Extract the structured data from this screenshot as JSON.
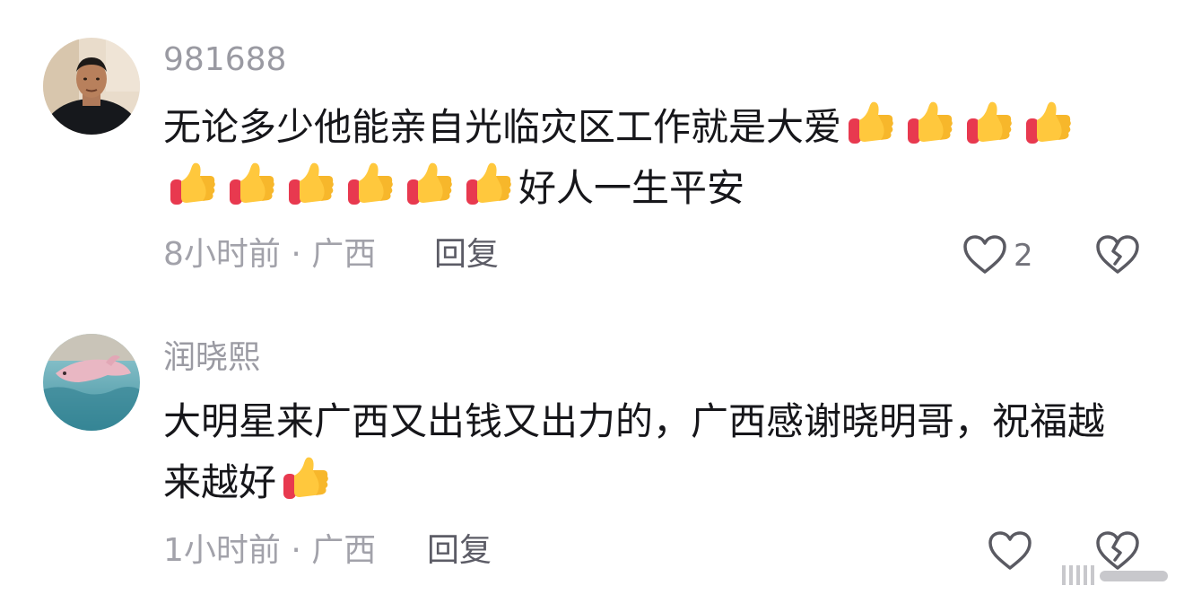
{
  "comments": [
    {
      "username": "981688",
      "avatar_icon": "user-avatar-man-photo",
      "text_before_emoji": "无论多少他能亲自光临灾区工作就是大爱",
      "text_after_emoji": "好人一生平安",
      "emoji_name": "thumbs-up-icon",
      "emoji_count": 10,
      "meta": "8小时前 · 广西",
      "reply_label": "回复",
      "like_count": "2"
    },
    {
      "username": "润晓熙",
      "avatar_icon": "user-avatar-dolphin-photo",
      "text_before_emoji": "大明星来广西又出钱又出力的，广西感谢晓明哥，祝福越来越好",
      "text_after_emoji": "",
      "emoji_name": "thumbs-up-icon",
      "emoji_count": 1,
      "meta": "1小时前 · 广西",
      "reply_label": "回复",
      "like_count": ""
    }
  ],
  "colors": {
    "text_primary": "#16161a",
    "text_secondary": "#9a9aa2",
    "reply": "#5c5c66",
    "icon_stroke": "#5a5a62"
  }
}
